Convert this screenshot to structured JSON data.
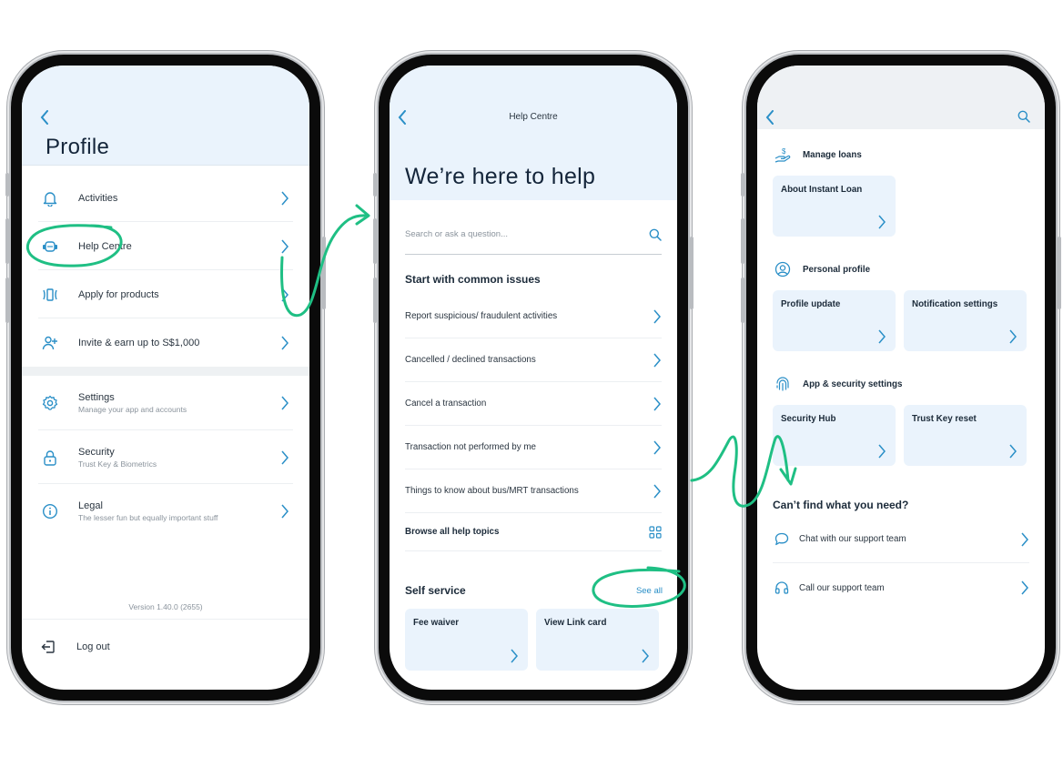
{
  "accent_color": "#2a8fc7",
  "annotation_color": "#1fbf84",
  "profile_screen": {
    "title": "Profile",
    "back_icon": "chevron-left-icon",
    "menu_group_1": [
      {
        "label": "Activities",
        "icon": "bell-icon"
      },
      {
        "label": "Help Centre",
        "icon": "headset-chat-icon"
      },
      {
        "label": "Apply for products",
        "icon": "card-apply-icon"
      },
      {
        "label": "Invite & earn up to S$1,000",
        "icon": "user-plus-icon"
      }
    ],
    "menu_group_2": [
      {
        "label": "Settings",
        "sublabel": "Manage your app and accounts",
        "icon": "gear-icon"
      },
      {
        "label": "Security",
        "sublabel": "Trust Key & Biometrics",
        "icon": "lock-icon"
      },
      {
        "label": "Legal",
        "sublabel": "The lesser fun but equally important stuff",
        "icon": "info-icon"
      }
    ],
    "version": "Version 1.40.0 (2655)",
    "logout_label": "Log out"
  },
  "help_screen": {
    "top_title": "Help Centre",
    "hero_title": "We’re here to help",
    "search_placeholder": "Search or ask a question...",
    "common_issues_heading": "Start with common issues",
    "common_issues": [
      "Report suspicious/ fraudulent activities",
      "Cancelled / declined transactions",
      "Cancel a transaction",
      "Transaction not performed by me",
      "Things to know about bus/MRT transactions"
    ],
    "browse_all_label": "Browse all help topics",
    "self_service_heading": "Self service",
    "see_all_label": "See all",
    "self_service_cards": [
      "Fee waiver",
      "View Link card"
    ]
  },
  "self_service_screen": {
    "groups": [
      {
        "heading": "Manage loans",
        "icon": "hand-dollar-icon",
        "cards": [
          "About Instant Loan"
        ]
      },
      {
        "heading": "Personal profile",
        "icon": "user-circle-icon",
        "cards": [
          "Profile update",
          "Notification settings"
        ]
      },
      {
        "heading": "App & security settings",
        "icon": "fingerprint-icon",
        "cards": [
          "Security Hub",
          "Trust Key reset"
        ]
      }
    ],
    "cant_find_heading": "Can’t find what you need?",
    "support_options": [
      {
        "label": "Chat with our support team",
        "icon": "chat-bubble-icon"
      },
      {
        "label": "Call our support team",
        "icon": "headphones-icon"
      }
    ]
  }
}
